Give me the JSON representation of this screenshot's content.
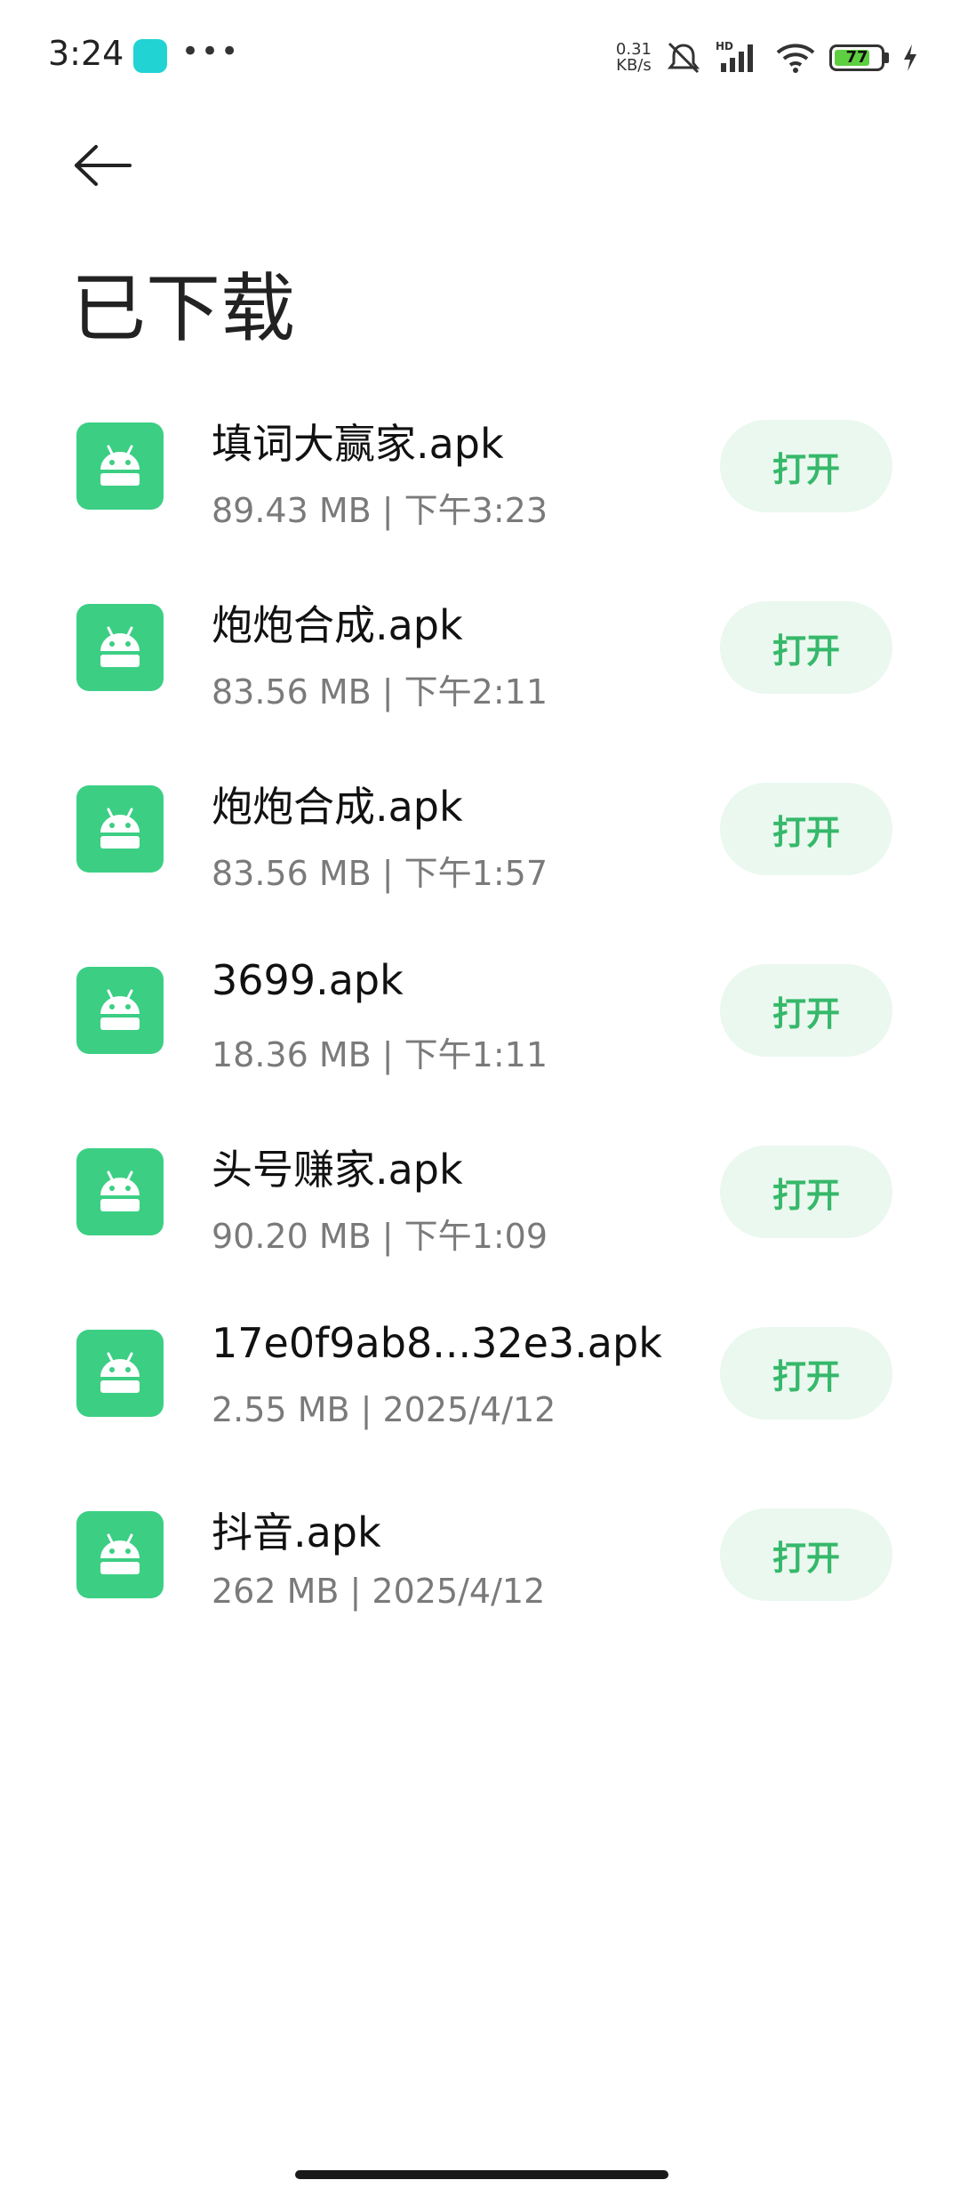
{
  "status_bar": {
    "time": "3:24",
    "network_speed_value": "0.31",
    "network_speed_unit": "KB/s",
    "network_label": "HD",
    "battery": "77",
    "battery_level": 0.77,
    "battery_color": "#5fcf42"
  },
  "header": {
    "title": "已下载"
  },
  "open_label": "打开",
  "accent": "#3ccf84",
  "items": [
    {
      "name": "填词大赢家.apk",
      "meta": "89.43 MB | 下午3:23"
    },
    {
      "name": "炮炮合成.apk",
      "meta": "83.56 MB | 下午2:11"
    },
    {
      "name": "炮炮合成.apk",
      "meta": "83.56 MB | 下午1:57"
    },
    {
      "name": "3699.apk",
      "meta": "18.36 MB | 下午1:11"
    },
    {
      "name": "头号赚家.apk",
      "meta": "90.20 MB | 下午1:09"
    },
    {
      "name": "17e0f9ab8...32e3.apk",
      "meta": "2.55 MB | 2025/4/12"
    },
    {
      "name": "抖音.apk",
      "meta": "262 MB | 2025/4/12"
    }
  ]
}
